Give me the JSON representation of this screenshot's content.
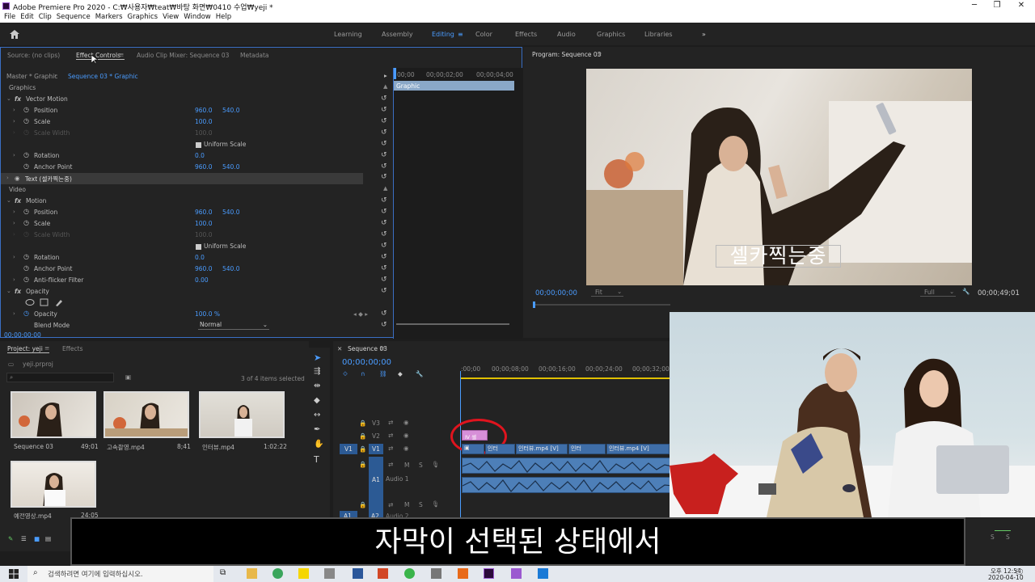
{
  "window": {
    "title": "Adobe Premiere Pro 2020 - C:₩사용자₩teat₩바탕 화면₩0410 수업₩yeji *",
    "minimize": "─",
    "maximize": "❐",
    "close": "✕"
  },
  "menu": [
    "File",
    "Edit",
    "Clip",
    "Sequence",
    "Markers",
    "Graphics",
    "View",
    "Window",
    "Help"
  ],
  "workspaces": {
    "items": [
      "Learning",
      "Assembly",
      "Editing",
      "Color",
      "Effects",
      "Audio",
      "Graphics",
      "Libraries"
    ],
    "active": "Editing",
    "more": "»"
  },
  "effect_controls": {
    "tabs": [
      "Source: (no clips)",
      "Effect Controls",
      "Audio Clip Mixer: Sequence 03",
      "Metadata"
    ],
    "active_tab": "Effect Controls",
    "master": "Master * Graphic",
    "sequence": "Sequence 03 * Graphic",
    "ruler": [
      "00;00",
      "00;00;02;00",
      "00;00;04;00"
    ],
    "clip_label": "Graphic",
    "section_graphics": "Graphics",
    "vector_motion": "Vector Motion",
    "text_layer": "Text (셀카찍는중)",
    "section_video": "Video",
    "motion": "Motion",
    "opacity_group": "Opacity",
    "rows_vector": [
      {
        "label": "Position",
        "v1": "960.0",
        "v2": "540.0"
      },
      {
        "label": "Scale",
        "v1": "100.0",
        "v2": ""
      },
      {
        "label": "Scale Width",
        "v1": "100.0",
        "v2": ""
      },
      {
        "label": "Uniform Scale",
        "v1": "",
        "v2": ""
      },
      {
        "label": "Rotation",
        "v1": "0.0",
        "v2": ""
      },
      {
        "label": "Anchor Point",
        "v1": "960.0",
        "v2": "540.0"
      }
    ],
    "rows_motion": [
      {
        "label": "Position",
        "v1": "960.0",
        "v2": "540.0"
      },
      {
        "label": "Scale",
        "v1": "100.0",
        "v2": ""
      },
      {
        "label": "Scale Width",
        "v1": "100.0",
        "v2": ""
      },
      {
        "label": "Uniform Scale",
        "v1": "",
        "v2": ""
      },
      {
        "label": "Rotation",
        "v1": "0.0",
        "v2": ""
      },
      {
        "label": "Anchor Point",
        "v1": "960.0",
        "v2": "540.0"
      },
      {
        "label": "Anti-flicker Filter",
        "v1": "0.00",
        "v2": ""
      }
    ],
    "opacity_label": "Opacity",
    "opacity_value": "100.0 %",
    "blend_label": "Blend Mode",
    "blend_value": "Normal",
    "timecode": "00;00;00;00"
  },
  "program": {
    "title": "Program: Sequence 03",
    "caption": "셀카찍는중",
    "timecode": "00;00;00;00",
    "fit": "Fit",
    "quality": "Full",
    "duration": "00;00;49;01"
  },
  "project": {
    "tabs": [
      "Project: yeji",
      "Effects"
    ],
    "file": "yeji.prproj",
    "selection": "3 of 4 items selected",
    "items": [
      {
        "name": "Sequence 03",
        "duration": "49;01"
      },
      {
        "name": "고속촬영.mp4",
        "duration": "8;41"
      },
      {
        "name": "인터뷰.mp4",
        "duration": "1:02:22"
      },
      {
        "name": "예전영상.mp4",
        "duration": "24;05"
      }
    ]
  },
  "timeline": {
    "tab": "Sequence 03",
    "timecode": "00;00;00;00",
    "ruler": [
      ":00;00",
      "00;00;08;00",
      "00;00;16;00",
      "00;00;24;00",
      "00;00;32;00"
    ],
    "tracks": [
      "V3",
      "V2",
      "V1",
      "A1",
      "A2"
    ],
    "audio_label": "Audio 1",
    "audio2_label": "Audio 2",
    "v2_clip": "Ⅳ 셀",
    "v1_clips": [
      "인터",
      "인터뷰.mp4 [V]",
      "인터",
      "인터뷰.mp4 [V]"
    ],
    "track_mute": "M",
    "track_solo": "S"
  },
  "subtitle": "자막이 선택된 상태에서",
  "taskbar": {
    "search": "검색하려면 여기에 입력하십시오.",
    "time": "오후 12:54",
    "date": "2020-04-10"
  },
  "colors": {
    "accent": "#4a9cff",
    "panel_border": "#3a6fc4",
    "highlight_circle": "#e0141e",
    "graphic_clip": "#d78fd8"
  }
}
